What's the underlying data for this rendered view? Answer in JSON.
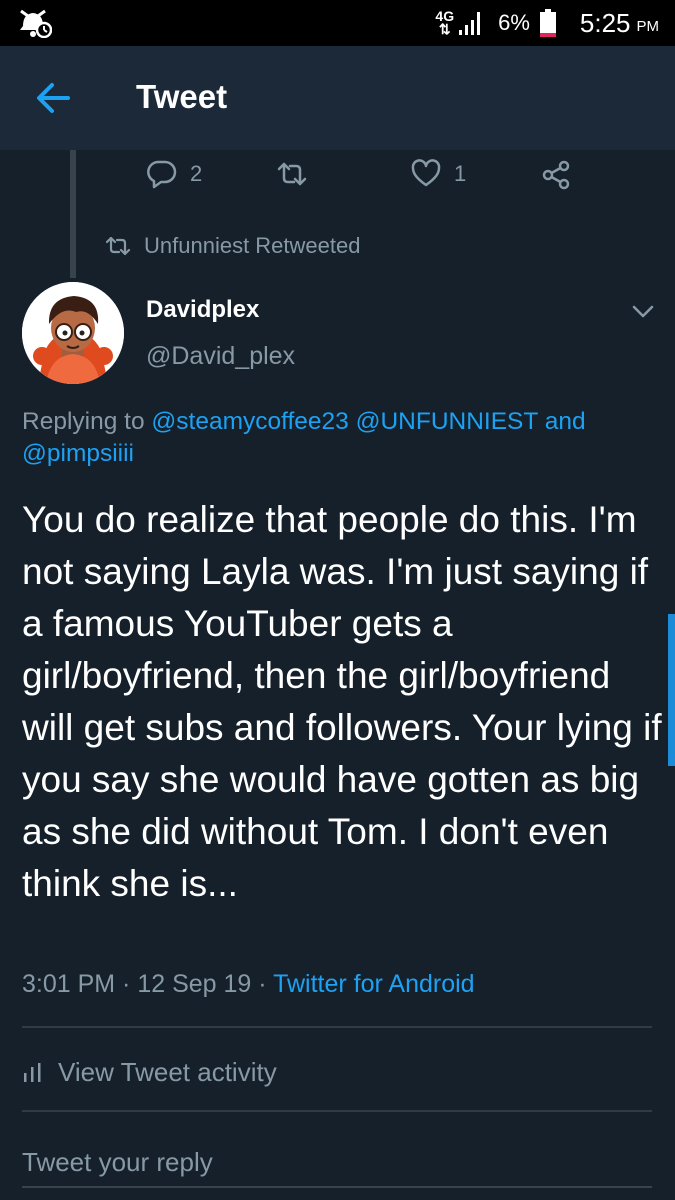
{
  "status_bar": {
    "network": "4G",
    "battery_percent": "6%",
    "time": "5:25",
    "ampm": "PM",
    "colors": {
      "battery_low": "#e0245e"
    }
  },
  "app_bar": {
    "back_icon": "arrow-left-icon",
    "title": "Tweet"
  },
  "previous_tweet_actions": {
    "reply_count": "2",
    "retweet_count": "",
    "like_count": "1"
  },
  "retweet_context": {
    "label": "Unfunniest Retweeted"
  },
  "tweet": {
    "author_name": "Davidplex",
    "author_handle": "@David_plex",
    "replying_prefix": "Replying to ",
    "replying_to": [
      "@steamycoffee23",
      "@UNFUNNIEST",
      "@pimpsiiii"
    ],
    "replying_and": " and",
    "text": "You do realize that people do this. I'm not saying Layla was. I'm just saying if a famous YouTuber gets a girl/boyfriend, then the girl/boyfriend will get subs and followers. Your lying if you say she would have gotten as big as she did without Tom. I don't even think she is...",
    "time": "3:01 PM",
    "date": "12 Sep 19",
    "separator": " · ",
    "source": "Twitter for Android"
  },
  "activity": {
    "label": "View Tweet activity"
  },
  "reply_box": {
    "placeholder": "Tweet your reply"
  },
  "theme": {
    "background": "#15202b",
    "app_bar": "#1c2938",
    "accent": "#1da1f2",
    "muted_text": "#8899a6",
    "divider": "#2f3b47"
  }
}
